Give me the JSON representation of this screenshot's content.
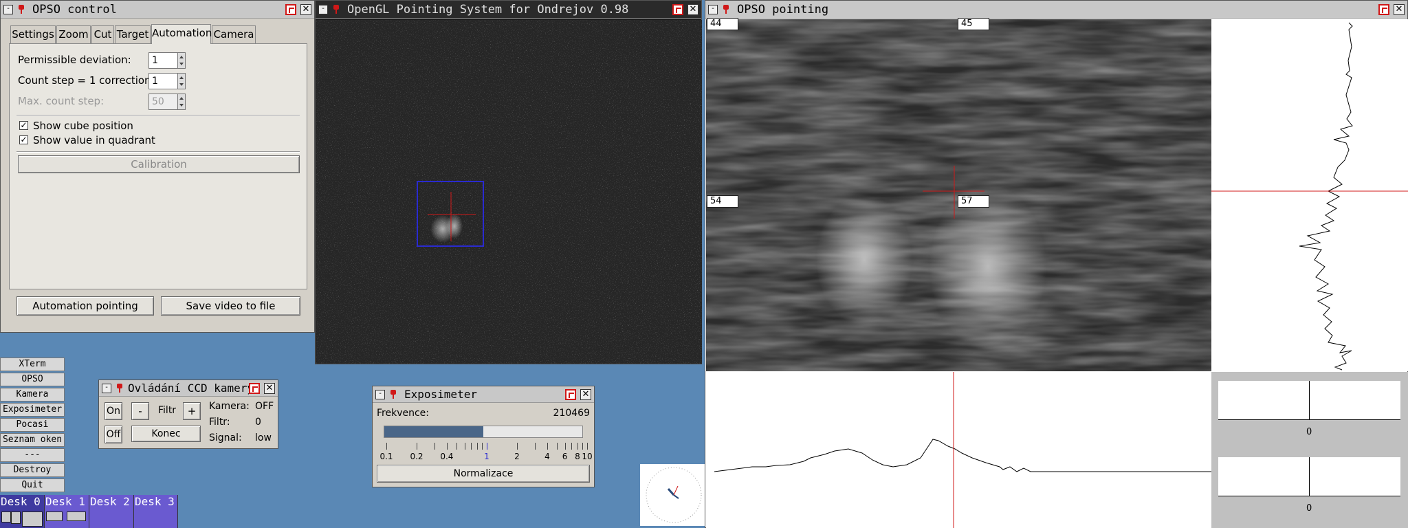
{
  "opso_control": {
    "title": "OPSO control",
    "tabs": [
      "Settings",
      "Zoom",
      "Cut",
      "Target",
      "Automation",
      "Camera"
    ],
    "active_tab": "Automation",
    "permissible_deviation_label": "Permissible deviation:",
    "permissible_deviation_value": "1",
    "count_step_label": "Count step = 1 correction:",
    "count_step_value": "1",
    "max_count_step_label": "Max. count step:",
    "max_count_step_value": "50",
    "show_cube_label": "Show cube position",
    "show_value_label": "Show value in quadrant",
    "calibration_label": "Calibration",
    "automation_pointing_label": "Automation pointing",
    "save_video_label": "Save video to file"
  },
  "opengl": {
    "title": "OpenGL Pointing System for Ondrejov 0.98"
  },
  "opso_pointing": {
    "title": "OPSO pointing",
    "quadrants": {
      "tl": "44",
      "tr": "45",
      "bl": "54",
      "br": "57"
    },
    "zero_label_1": "0",
    "zero_label_2": "0"
  },
  "taskbar": {
    "buttons": [
      "XTerm",
      "OPSO",
      "Kamera",
      "Exposimeter",
      "Pocasi",
      "Seznam oken",
      "---",
      "Destroy",
      "Quit"
    ],
    "desks": [
      "Desk 0",
      "Desk 1",
      "Desk 2",
      "Desk 3"
    ]
  },
  "ccd": {
    "title": "Ovládání CCD kamery",
    "on_label": "On",
    "off_label": "Off",
    "minus_label": "-",
    "filtr_label": "Filtr",
    "plus_label": "+",
    "konec_label": "Konec",
    "kamera_label": "Kamera:",
    "kamera_value": "OFF",
    "filtr_value_label": "Filtr:",
    "filtr_value": "0",
    "signal_label": "Signal:",
    "signal_value": "low"
  },
  "exposimeter": {
    "title": "Exposimeter",
    "frequency_label": "Frekvence:",
    "frequency_value": "210469",
    "level_fraction": 0.5,
    "scale_labels": [
      "0.1",
      "0.2",
      "0.4",
      "1",
      "2",
      "4",
      "6",
      "8",
      "10"
    ],
    "normalize_label": "Normalizace"
  },
  "colors": {
    "accent_red": "#d01818",
    "desktop_blue": "#5a88b5"
  }
}
